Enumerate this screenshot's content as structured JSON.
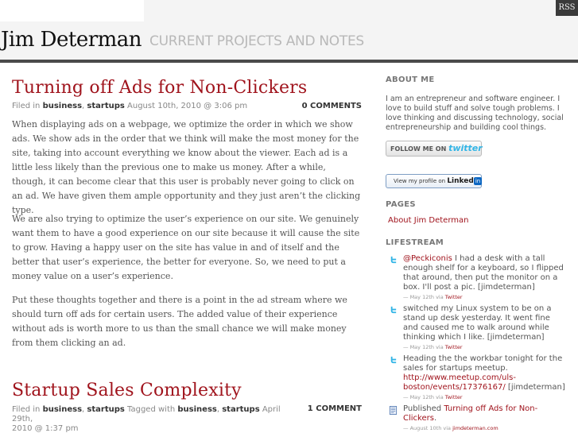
{
  "topbar": {
    "rss_label": "RSS"
  },
  "header": {
    "site_title": "Jim Determan",
    "tagline": "CURRENT PROJECTS AND NOTES"
  },
  "posts": [
    {
      "title": "Turning off Ads for Non-Clickers",
      "meta": {
        "filed_in": "Filed in",
        "cat1": "business",
        "sep": ",",
        "cat2": "startups",
        "date": "August 10th, 2010 @ 3:06 pm"
      },
      "comments": "0 COMMENTS",
      "paragraphs": [
        "When displaying ads on a webpage, we optimize the order in which we show ads. We show ads in the order that we think will make the most money for the site, taking into account everything we know about the viewer.  Each ad is a little less likely than the previous one to make us money. After a while, though, it can become clear that this user is probably never going to click on an ad.  We have given them ample opportunity and they just aren’t the clicking type.",
        "We are also trying to optimize the user’s experience on our site.  We genuinely want them to have a good experience on our site because it will cause the site to grow. Having a happy user on the site has value in and of itself and the better that user’s experience, the better for everyone. So, we need to put a money value on a user’s experience.",
        "Put these thoughts together and there is a point in the ad stream where we should turn off ads for certain users.  The added value of their experience without ads is worth more to us than the small chance we will make money from them clicking an ad."
      ]
    },
    {
      "title": "Startup Sales Complexity",
      "meta": {
        "filed_in": "Filed in",
        "cat1": "business",
        "sep": ",",
        "cat2": "startups",
        "tagged": "Tagged with",
        "tag1": "business",
        "tag2": "startups",
        "date_line1": "April 29th,",
        "date_line2": "2010 @ 1:37 pm"
      },
      "comments": "1 COMMENT"
    }
  ],
  "sidebar": {
    "about": {
      "heading": "ABOUT ME",
      "text": "I am an entrepreneur and software engineer. I love to build stuff and solve tough problems. I love thinking and discussing technology, social entrepreneurship and building cool things.",
      "follow_prefix": "FOLLOW ME ON",
      "follow_brand": "twitter",
      "linkedin_prefix": "View my profile on",
      "linkedin_brand": "Linked",
      "linkedin_in": "in"
    },
    "pages": {
      "heading": "PAGES",
      "items": [
        "About Jim Determan"
      ]
    },
    "lifestream": {
      "heading": "LIFESTREAM",
      "items": [
        {
          "icon": "twitter-icon",
          "mention": "@Peckiconis",
          "text": " I had a desk with a tall enough shelf for a keyboard, so I flipped that around, then put the monitor on a box. I'll post a pic. [jimdeterman]",
          "date": "— May 12th via",
          "source": "Twitter"
        },
        {
          "icon": "twitter-icon",
          "text": "switched my Linux system to be on a stand up desk yesterday. It went fine and caused me to walk around while thinking which I like. [jimdeterman]",
          "date": "— May 12th via",
          "source": "Twitter"
        },
        {
          "icon": "twitter-icon",
          "text": "Heading the the workbar tonight for the sales for startups meetup.",
          "url": "http://www.meetup.com/uls-boston/events/17376167/",
          "text_after": " [jimdeterman]",
          "date": "— May 12th via",
          "source": "Twitter"
        },
        {
          "icon": "blog-post-icon",
          "prefix": "Published ",
          "link": "Turning off Ads for Non-Clickers",
          "suffix": ".",
          "date": "— August 10th via",
          "source": "jimdeterman.com"
        }
      ]
    }
  }
}
